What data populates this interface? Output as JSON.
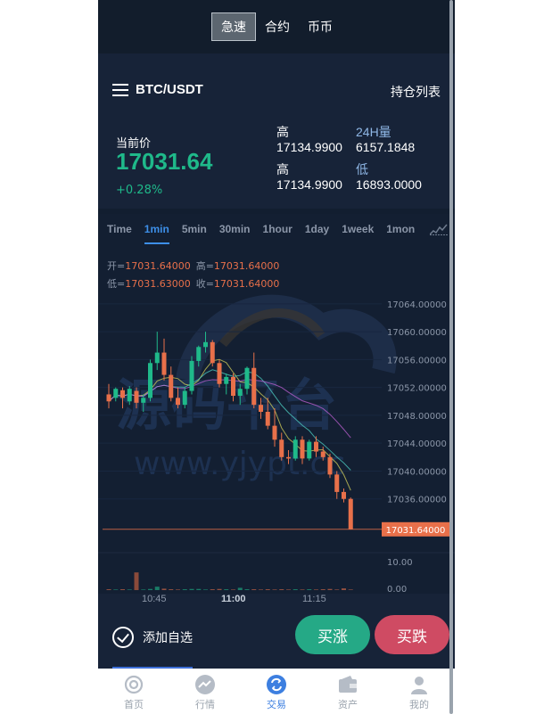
{
  "top_tabs": [
    {
      "label": "急速",
      "active": true
    },
    {
      "label": "合约",
      "active": false
    },
    {
      "label": "币币",
      "active": false
    }
  ],
  "pair": {
    "name": "BTC/USDT",
    "positions_link": "持仓列表"
  },
  "price": {
    "current_label": "当前价",
    "current_value": "17031.64",
    "change": "+0.28%",
    "stats": [
      {
        "label": "高",
        "value": "17134.9900"
      },
      {
        "label": "24H量",
        "value": "6157.1848"
      },
      {
        "label": "高",
        "value": "17134.9900"
      },
      {
        "label": "低",
        "value": "16893.0000"
      }
    ]
  },
  "periods": [
    {
      "label": "Time",
      "active": false
    },
    {
      "label": "1min",
      "active": true
    },
    {
      "label": "5min",
      "active": false
    },
    {
      "label": "30min",
      "active": false
    },
    {
      "label": "1hour",
      "active": false
    },
    {
      "label": "1day",
      "active": false
    },
    {
      "label": "1week",
      "active": false
    },
    {
      "label": "1mon",
      "active": false
    }
  ],
  "ohlc": {
    "open_label": "开=",
    "open": "17031.64000",
    "high_label": "高=",
    "high": "17031.64000",
    "low_label": "低=",
    "low": "17031.63000",
    "close_label": "收=",
    "close": "17031.64000"
  },
  "watermark": {
    "main": "源码平台",
    "sub": "www.yjypt.cc"
  },
  "colors": {
    "up": "#1fb98a",
    "down": "#e8704a",
    "accent": "#3d8fe8",
    "buy": "#25a986",
    "sell": "#cf4b63"
  },
  "chart_data": {
    "type": "candlestick",
    "y_ticks": [
      "17064.00000",
      "17060.00000",
      "17056.00000",
      "17052.00000",
      "17048.00000",
      "17044.00000",
      "17040.00000",
      "17036.00000"
    ],
    "last_price_label": "17031.64000",
    "last_price": 17031.64,
    "ylim": [
      17028.8,
      17068.2
    ],
    "volume_ticks": [
      "10.00",
      "0.00"
    ],
    "x_ticks": [
      "10:45",
      "11:00",
      "11:15"
    ],
    "candles": [
      {
        "o": 17051.0,
        "h": 17052.5,
        "l": 17049.0,
        "c": 17050.0
      },
      {
        "o": 17050.5,
        "h": 17052.0,
        "l": 17050.0,
        "c": 17051.8
      },
      {
        "o": 17051.6,
        "h": 17052.0,
        "l": 17049.0,
        "c": 17050.5
      },
      {
        "o": 17050.0,
        "h": 17052.2,
        "l": 17049.5,
        "c": 17051.8
      },
      {
        "o": 17051.5,
        "h": 17052.0,
        "l": 17049.0,
        "c": 17049.8
      },
      {
        "o": 17049.8,
        "h": 17051.0,
        "l": 17048.5,
        "c": 17050.5
      },
      {
        "o": 17050.5,
        "h": 17056.0,
        "l": 17050.0,
        "c": 17055.5
      },
      {
        "o": 17055.5,
        "h": 17060.0,
        "l": 17054.5,
        "c": 17057.0
      },
      {
        "o": 17057.0,
        "h": 17059.0,
        "l": 17053.0,
        "c": 17053.8
      },
      {
        "o": 17053.8,
        "h": 17055.0,
        "l": 17050.0,
        "c": 17050.5
      },
      {
        "o": 17050.5,
        "h": 17052.0,
        "l": 17049.0,
        "c": 17049.5
      },
      {
        "o": 17049.5,
        "h": 17052.0,
        "l": 17049.0,
        "c": 17051.5
      },
      {
        "o": 17051.5,
        "h": 17056.5,
        "l": 17051.0,
        "c": 17055.8
      },
      {
        "o": 17055.8,
        "h": 17058.0,
        "l": 17055.0,
        "c": 17057.8
      },
      {
        "o": 17057.8,
        "h": 17060.0,
        "l": 17057.0,
        "c": 17058.5
      },
      {
        "o": 17058.5,
        "h": 17058.8,
        "l": 17055.0,
        "c": 17055.5
      },
      {
        "o": 17055.5,
        "h": 17056.0,
        "l": 17052.0,
        "c": 17052.5
      },
      {
        "o": 17052.5,
        "h": 17054.0,
        "l": 17051.0,
        "c": 17053.5
      },
      {
        "o": 17053.5,
        "h": 17054.0,
        "l": 17050.0,
        "c": 17050.8
      },
      {
        "o": 17050.8,
        "h": 17052.5,
        "l": 17049.5,
        "c": 17051.8
      },
      {
        "o": 17051.8,
        "h": 17055.0,
        "l": 17051.0,
        "c": 17054.8
      },
      {
        "o": 17054.8,
        "h": 17057.0,
        "l": 17049.0,
        "c": 17049.5
      },
      {
        "o": 17049.5,
        "h": 17050.5,
        "l": 17047.5,
        "c": 17048.5
      },
      {
        "o": 17048.5,
        "h": 17050.5,
        "l": 17046.0,
        "c": 17046.5
      },
      {
        "o": 17046.5,
        "h": 17049.0,
        "l": 17043.5,
        "c": 17044.5
      },
      {
        "o": 17044.5,
        "h": 17045.5,
        "l": 17041.5,
        "c": 17042.0
      },
      {
        "o": 17042.0,
        "h": 17043.0,
        "l": 17041.0,
        "c": 17041.8
      },
      {
        "o": 17041.8,
        "h": 17045.0,
        "l": 17041.5,
        "c": 17044.5
      },
      {
        "o": 17044.5,
        "h": 17045.0,
        "l": 17041.0,
        "c": 17041.8
      },
      {
        "o": 17041.8,
        "h": 17044.5,
        "l": 17041.5,
        "c": 17044.2
      },
      {
        "o": 17044.2,
        "h": 17045.0,
        "l": 17042.0,
        "c": 17042.8
      },
      {
        "o": 17042.8,
        "h": 17043.5,
        "l": 17041.5,
        "c": 17042.0
      },
      {
        "o": 17042.0,
        "h": 17042.5,
        "l": 17039.0,
        "c": 17039.5
      },
      {
        "o": 17039.5,
        "h": 17040.0,
        "l": 17036.0,
        "c": 17037.0
      },
      {
        "o": 17037.0,
        "h": 17037.5,
        "l": 17035.5,
        "c": 17036.0
      },
      {
        "o": 17036.0,
        "h": 17036.2,
        "l": 17031.6,
        "c": 17031.64
      }
    ],
    "volumes": [
      0.3,
      0.2,
      0.3,
      0.2,
      0.3,
      0.2,
      0.4,
      1.2,
      0.5,
      0.3,
      0.2,
      0.3,
      0.4,
      0.4,
      0.2,
      0.3,
      0.4,
      0.3,
      0.2,
      0.8,
      0.3,
      0.3,
      0.2,
      0.3,
      0.2,
      0.3,
      0.2,
      0.3,
      0.2,
      0.3,
      0.2,
      0.3,
      0.4,
      0.2,
      0.6,
      0.2
    ],
    "volume_spike": {
      "index": 4,
      "value": 6.2
    }
  },
  "action_bar": {
    "favorite_label": "添加自选",
    "buy_label": "买涨",
    "sell_label": "买跌"
  },
  "bottom_nav": [
    {
      "label": "首页",
      "icon": "home-icon",
      "active": false
    },
    {
      "label": "行情",
      "icon": "market-icon",
      "active": false
    },
    {
      "label": "交易",
      "icon": "trade-icon",
      "active": true
    },
    {
      "label": "资产",
      "icon": "wallet-icon",
      "active": false
    },
    {
      "label": "我的",
      "icon": "profile-icon",
      "active": false
    }
  ]
}
